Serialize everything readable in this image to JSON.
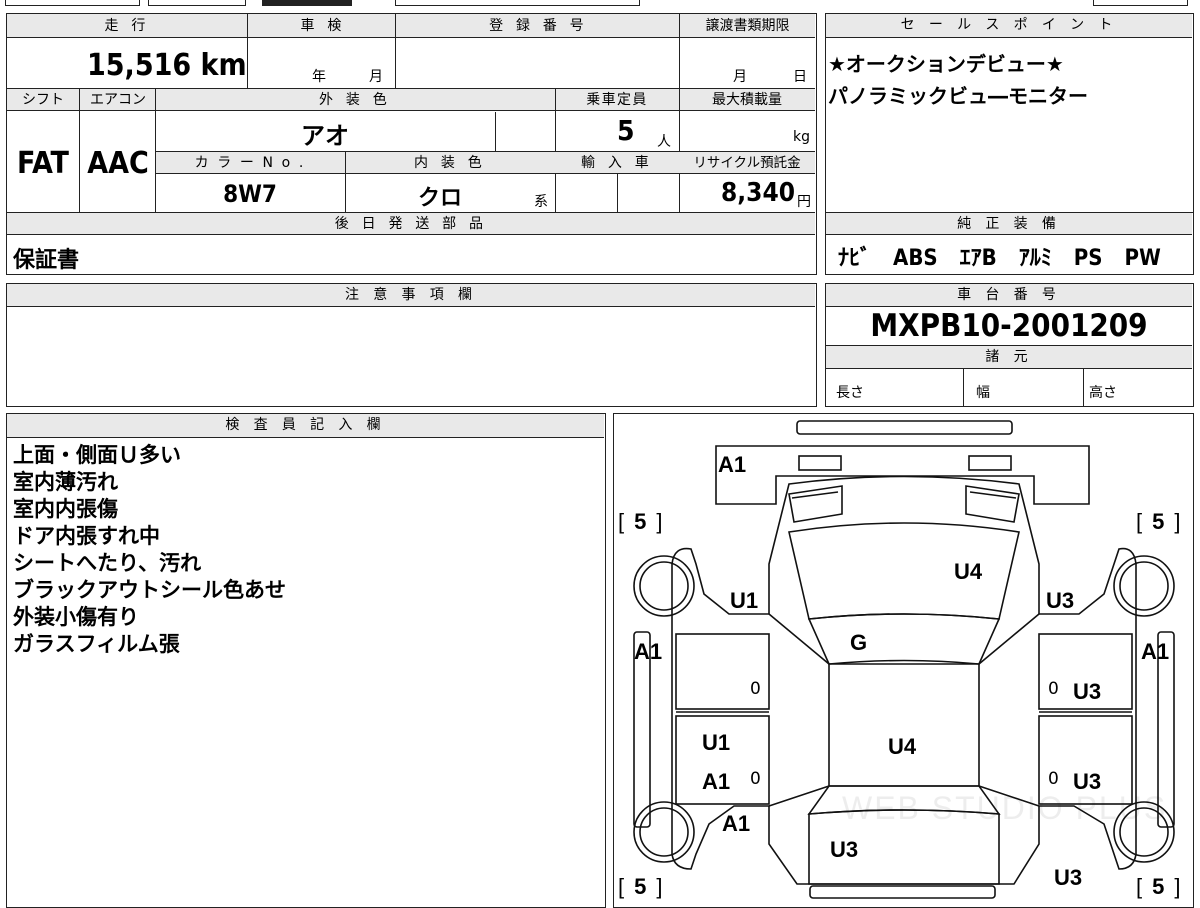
{
  "vehicle": {
    "labels": {
      "mileage": "走 行",
      "inspection": "車 検",
      "registration": "登 録 番 号",
      "transfer_deadline": "譲渡書類期限",
      "shift": "シフト",
      "aircon": "エアコン",
      "exterior_color": "外 装 色",
      "capacity": "乗車定員",
      "max_load": "最大積載量",
      "color_no": "カ ラ ー N o .",
      "interior_color": "内 装 色",
      "import": "輸 入 車",
      "recycle": "リサイクル預託金"
    },
    "mileage": "15,516 km",
    "inspection_year_unit": "年",
    "inspection_month_unit": "月",
    "transfer_month_unit": "月",
    "transfer_day_unit": "日",
    "shift": "FAT",
    "aircon": "AAC",
    "exterior_color": "アオ",
    "capacity": "5",
    "capacity_unit": "人",
    "max_load_unit": "kg",
    "color_no": "8W7",
    "interior_color": "クロ",
    "interior_color_suffix": "系",
    "recycle_fee": "8,340",
    "recycle_unit": "円"
  },
  "sales_points": {
    "title": "セ ー ル ス ポ イ ン ト",
    "lines": [
      "★オークションデビュー★",
      "パノラミックビュ―モニター"
    ]
  },
  "shipping": {
    "title": "後 日 発 送 部 品",
    "value": "保証書"
  },
  "equipment": {
    "title": "純 正 装 備",
    "value": "ﾅﾋﾞ　ABS　ｴｱB　ｱﾙﾐ　PS　PW"
  },
  "notes": {
    "title": "注 意 事 項 欄"
  },
  "chassis": {
    "title": "車 台 番 号",
    "number": "MXPB10-2001209",
    "spec_title": "諸 元",
    "length_label": "長さ",
    "width_label": "幅",
    "height_label": "高さ"
  },
  "inspector": {
    "title": "検 査 員 記 入 欄",
    "lines": [
      "上面・側面Ｕ多い",
      "室内薄汚れ",
      "室内内張傷",
      "ドア内張すれ中",
      "シートへたり、汚れ",
      "ブラックアウトシール色あせ",
      "外装小傷有り",
      "ガラスフィルム張"
    ]
  },
  "diagram": {
    "tire_label": "5",
    "marks": {
      "front_a1": "A1",
      "u4_hood": "U4",
      "u1_left_front": "U1",
      "u3_right_front": "U3",
      "g_windshield": "G",
      "a1_left_side": "A1",
      "a1_right_side": "A1",
      "u3_right_door_front": "U3",
      "u4_roof": "U4",
      "u1_left_door_rear": "U1",
      "a1_left_door_rear": "A1",
      "u3_right_door_rear": "U3",
      "a1_left_rear": "A1",
      "u3_trunk": "U3",
      "u3_right_rear": "U3",
      "zero_l1": "0",
      "zero_l2": "0",
      "zero_r1": "0",
      "zero_r2": "0"
    }
  },
  "watermark": "WEB STUDIO PLUS"
}
